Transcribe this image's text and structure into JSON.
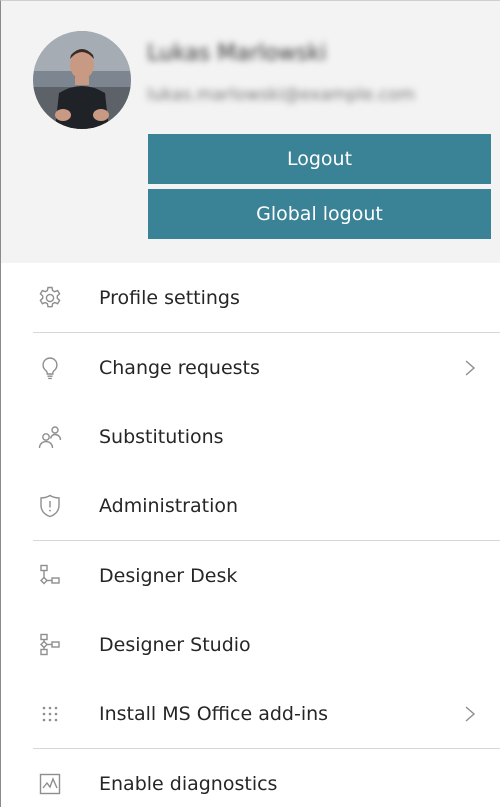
{
  "profile": {
    "name": "Lukas Marlowski",
    "email": "lukas.marlowski@example.com"
  },
  "buttons": {
    "logout": "Logout",
    "global_logout": "Global logout"
  },
  "menu": {
    "profile_settings": "Profile settings",
    "change_requests": "Change requests",
    "substitutions": "Substitutions",
    "administration": "Administration",
    "designer_desk": "Designer Desk",
    "designer_studio": "Designer Studio",
    "install_office": "Install MS Office add-ins",
    "enable_diagnostics": "Enable diagnostics"
  },
  "icons": {
    "profile_settings": "gear-icon",
    "change_requests": "lightbulb-icon",
    "substitutions": "users-icon",
    "administration": "shield-icon",
    "designer_desk": "flow-diagram-icon",
    "designer_studio": "studio-diagram-icon",
    "install_office": "grid-dots-icon",
    "enable_diagnostics": "chart-icon",
    "submenu": "chevron-right-icon"
  },
  "colors": {
    "accent": "#3a8295",
    "profile_bg": "#f3f3f3",
    "icon": "#8e8e8e",
    "divider": "#d8d8d8"
  }
}
